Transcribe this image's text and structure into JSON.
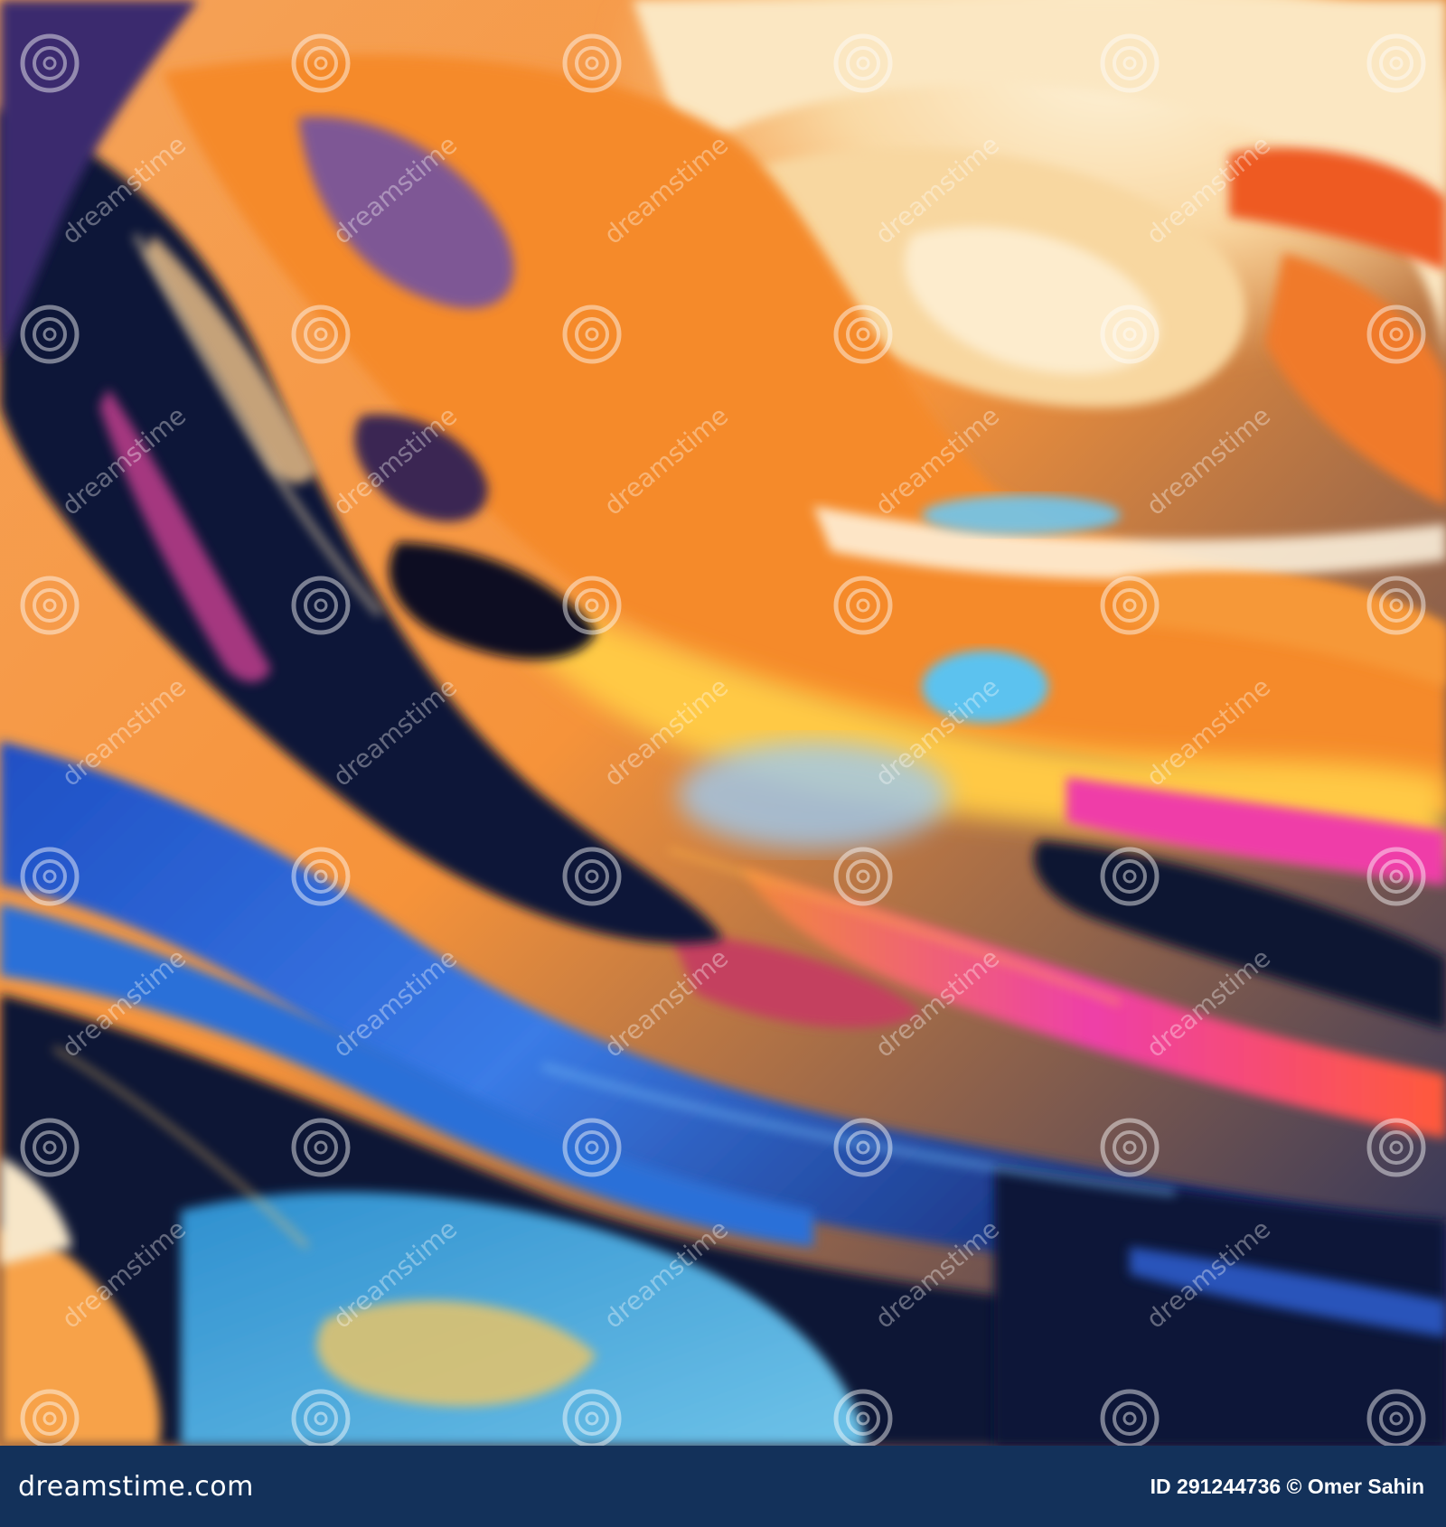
{
  "watermark": {
    "text": "dreamstime",
    "icon": "spiral-logo-icon"
  },
  "footer": {
    "logo_text": "dreamstime.com",
    "credit_text": "ID 291244736 © Omer Sahin",
    "background_color": "#13315a",
    "text_color": "#ffffff"
  },
  "palette": {
    "cream": "#f9dfb0",
    "orange": "#f5892c",
    "deep_orange": "#e9561c",
    "yellow": "#ffc83a",
    "magenta": "#ef3ca5",
    "royal_blue": "#2f5fd1",
    "sky_blue": "#54b8ef",
    "navy": "#0c1434",
    "purple": "#4a2a7a"
  }
}
